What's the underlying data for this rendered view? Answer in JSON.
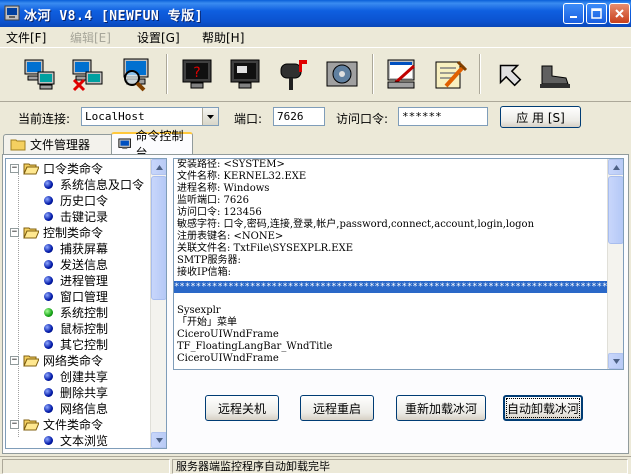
{
  "window": {
    "title": "冰河 V8.4 [NEWFUN 专版]"
  },
  "menu": {
    "file": "文件[F]",
    "edit": "编辑[E]",
    "settings": "设置[G]",
    "help": "帮助[H]"
  },
  "toolbar": {
    "icons": [
      "add-host-icon",
      "delete-host-icon",
      "find-host-icon",
      "capture-screen-icon",
      "control-screen-icon",
      "mail-icon",
      "config-icon",
      "settings-icon",
      "remote-control-icon",
      "back-icon",
      "exit-icon"
    ]
  },
  "connection": {
    "current_label": "当前连接:",
    "current_value": "LocalHost",
    "port_label": "端口:",
    "port_value": "7626",
    "password_label": "访问口令:",
    "password_value": "******",
    "apply_label": "应 用 [S]"
  },
  "tabs": {
    "file_manager": "文件管理器",
    "command_console": "命令控制台"
  },
  "tree": {
    "groups": [
      {
        "label": "口令类命令",
        "items": [
          "系统信息及口令",
          "历史口令",
          "击键记录"
        ]
      },
      {
        "label": "控制类命令",
        "items": [
          "捕获屏幕",
          "发送信息",
          "进程管理",
          "窗口管理",
          "系统控制",
          "鼠标控制",
          "其它控制"
        ]
      },
      {
        "label": "网络类命令",
        "items": [
          "创建共享",
          "删除共享",
          "网络信息"
        ]
      },
      {
        "label": "文件类命令",
        "items": [
          "文本浏览"
        ]
      }
    ]
  },
  "log": {
    "lines": [
      "安装路径: <SYSTEM>",
      "文件名称: KERNEL32.EXE",
      "进程名称: Windows",
      "监听端口: 7626",
      "访问口令: 123456",
      "敏感字符: 口令,密码,连接,登录,帐户,password,connect,account,login,logon",
      "注册表键名: <NONE>",
      "关联文件名: TxtFile\\SYSEXPLR.EXE",
      "SMTP服务器:",
      "接收IP信箱:"
    ],
    "separator": "************************************************************************************",
    "lines2": [
      "Sysexplr",
      "「开始」菜单",
      "CiceroUIWndFrame",
      "TF_FloatingLangBar_WndTitle",
      "CiceroUIWndFrame"
    ]
  },
  "actions": {
    "shutdown": "远程关机",
    "reboot": "远程重启",
    "reload": "重新加载冰河",
    "uninstall": "自动卸载冰河"
  },
  "status": {
    "message": "服务器端监控程序自动卸载完毕"
  }
}
